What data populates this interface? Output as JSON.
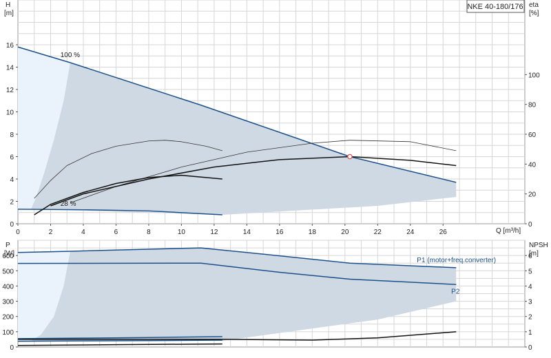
{
  "colors": {
    "envelope_fill": "#cfd9e3",
    "envelope_light": "#eaf3fb",
    "grid": "#d6d6d6",
    "pump_curve": "#1b4f8a",
    "thin_curve": "#333333",
    "eff_curve": "#111111",
    "duty_point": "#e04040"
  },
  "chart_data": [
    {
      "type": "line",
      "panel": "head",
      "title": "NKE 40-180/176",
      "xlabel": "Q [m³/h]",
      "ylabel": "H\n[m]",
      "y2label": "eta\n[%]",
      "xlim": [
        0,
        31
      ],
      "ylim": [
        0,
        20
      ],
      "y2lim": [
        0,
        150
      ],
      "x_ticks": [
        0,
        2,
        4,
        6,
        8,
        10,
        12,
        14,
        16,
        18,
        20,
        22,
        24,
        26
      ],
      "x_tick_labels": [
        "0",
        "2",
        "4",
        "6",
        "8",
        "10",
        "12",
        "14",
        "16",
        "18",
        "20",
        "22",
        "24",
        "26"
      ],
      "y_ticks": [
        0,
        2,
        4,
        6,
        8,
        10,
        12,
        14,
        16
      ],
      "y_tick_labels": [
        "0",
        "2",
        "4",
        "6",
        "8",
        "10",
        "12",
        "14",
        "16"
      ],
      "y2_ticks": [
        0,
        20,
        40,
        60,
        80,
        100
      ],
      "y2_tick_labels": [
        "0",
        "20",
        "40",
        "60",
        "80",
        "100"
      ],
      "grid": true,
      "labels": [
        {
          "text": "100 %",
          "x": 2.6,
          "y": 14.9
        },
        {
          "text": "28 %",
          "x": 2.6,
          "y": 1.6
        }
      ],
      "duty_point": {
        "x": 20.3,
        "y": 6.0
      },
      "envelope": {
        "upper": [
          [
            0.8,
            1.3
          ],
          [
            3.2,
            14.4
          ],
          [
            11.2,
            10.6
          ],
          [
            20.3,
            6.0
          ],
          [
            26.8,
            3.7
          ]
        ],
        "lower": [
          [
            26.8,
            2.4
          ],
          [
            22,
            1.6
          ],
          [
            12.5,
            0.8
          ],
          [
            3.2,
            1.2
          ],
          [
            0.8,
            1.3
          ]
        ]
      },
      "low_flow_zone": [
        [
          0,
          15.8
        ],
        [
          3.2,
          14.4
        ],
        [
          2.8,
          11
        ],
        [
          2.2,
          7.5
        ],
        [
          1.6,
          4.5
        ],
        [
          1.1,
          2.3
        ],
        [
          0.8,
          1.3
        ],
        [
          0,
          1.3
        ]
      ],
      "series": [
        {
          "role": "pump-100",
          "axis": "left",
          "style": "blue",
          "points": [
            [
              0,
              15.8
            ],
            [
              3.2,
              14.4
            ],
            [
              11.2,
              10.6
            ],
            [
              20.3,
              6.0
            ],
            [
              26.8,
              3.7
            ]
          ]
        },
        {
          "role": "pump-28",
          "axis": "left",
          "style": "blue",
          "points": [
            [
              0,
              1.3
            ],
            [
              4,
              1.25
            ],
            [
              8,
              1.15
            ],
            [
              12.5,
              0.8
            ]
          ]
        },
        {
          "role": "eff-100",
          "axis": "right",
          "style": "thin",
          "points": [
            [
              3.2,
              14
            ],
            [
              6,
              25
            ],
            [
              10,
              38
            ],
            [
              14,
              48
            ],
            [
              18,
              54
            ],
            [
              20.3,
              56
            ],
            [
              24,
              55
            ],
            [
              26.8,
              49
            ]
          ]
        },
        {
          "role": "eff-28",
          "axis": "right",
          "style": "thin",
          "points": [
            [
              1.0,
              17
            ],
            [
              2,
              29
            ],
            [
              3,
              39
            ],
            [
              4.5,
              47
            ],
            [
              6,
              52
            ],
            [
              8,
              55.5
            ],
            [
              9,
              56
            ],
            [
              10,
              55
            ],
            [
              11.5,
              52
            ],
            [
              12.5,
              49
            ]
          ]
        },
        {
          "role": "eff-mid",
          "axis": "right",
          "style": "bold",
          "points": [
            [
              2,
              12
            ],
            [
              4,
              20
            ],
            [
              8,
              30
            ],
            [
              12,
              38
            ],
            [
              16,
              43
            ],
            [
              20.3,
              45
            ],
            [
              24,
              42.5
            ],
            [
              26.8,
              39
            ]
          ]
        },
        {
          "role": "eff-28b",
          "axis": "right",
          "style": "bold",
          "points": [
            [
              1.0,
              6
            ],
            [
              2,
              13
            ],
            [
              4,
              21
            ],
            [
              6,
              27
            ],
            [
              8,
              31
            ],
            [
              10,
              32.5
            ],
            [
              12.5,
              30
            ]
          ]
        }
      ]
    },
    {
      "type": "line",
      "panel": "power",
      "xlabel": "",
      "ylabel": "P\n[W]",
      "y2label": "NPSH\n[m]",
      "xlim": [
        0,
        31
      ],
      "ylim": [
        0,
        700
      ],
      "y2lim": [
        0,
        7
      ],
      "y_ticks": [
        0,
        100,
        200,
        300,
        400,
        500,
        600
      ],
      "y_tick_labels": [
        "0",
        "100",
        "200",
        "300",
        "400",
        "500",
        "600"
      ],
      "y2_ticks": [
        0,
        1,
        2,
        3,
        4,
        5,
        6
      ],
      "y2_tick_labels": [
        "0",
        "1",
        "2",
        "3",
        "4",
        "5",
        "6"
      ],
      "grid": true,
      "labels": [
        {
          "text": "P1 (motor+freq.converter)",
          "x": 24.4,
          "y": 555
        },
        {
          "text": "P2",
          "x": 26.5,
          "y": 350
        }
      ],
      "envelope": {
        "upper": [
          [
            0,
            620
          ],
          [
            3.2,
            628
          ],
          [
            11.2,
            650
          ],
          [
            14,
            620
          ],
          [
            20.3,
            550
          ],
          [
            26.8,
            520
          ]
        ],
        "lower": [
          [
            26.8,
            300
          ],
          [
            22,
            180
          ],
          [
            12.5,
            40
          ],
          [
            3.2,
            40
          ],
          [
            0,
            40
          ]
        ]
      },
      "low_flow_zone": [
        [
          0,
          620
        ],
        [
          3.2,
          628
        ],
        [
          2.8,
          400
        ],
        [
          2.2,
          200
        ],
        [
          1.4,
          80
        ],
        [
          0.8,
          40
        ],
        [
          0,
          40
        ]
      ],
      "series": [
        {
          "role": "P1-100",
          "axis": "left",
          "style": "blue",
          "points": [
            [
              0,
              620
            ],
            [
              3.2,
              628
            ],
            [
              11.2,
              650
            ],
            [
              14,
              620
            ],
            [
              20.3,
              550
            ],
            [
              26.8,
              520
            ]
          ]
        },
        {
          "role": "P2-100",
          "axis": "left",
          "style": "blue",
          "points": [
            [
              0,
              548
            ],
            [
              11.2,
              550
            ],
            [
              16,
              490
            ],
            [
              20.3,
              445
            ],
            [
              26.8,
              410
            ]
          ]
        },
        {
          "role": "P1-28",
          "axis": "left",
          "style": "blue",
          "points": [
            [
              0,
              55
            ],
            [
              4,
              58
            ],
            [
              8,
              62
            ],
            [
              12.5,
              68
            ]
          ]
        },
        {
          "role": "P2-28",
          "axis": "left",
          "style": "blue",
          "points": [
            [
              0,
              38
            ],
            [
              4,
              40
            ],
            [
              8,
              42
            ],
            [
              12.5,
              45
            ]
          ]
        },
        {
          "role": "NPSH",
          "axis": "right",
          "style": "bold",
          "points": [
            [
              0,
              0.5
            ],
            [
              6,
              0.5
            ],
            [
              12.5,
              0.5
            ],
            [
              18,
              0.45
            ],
            [
              22,
              0.6
            ],
            [
              26.8,
              1.0
            ]
          ]
        },
        {
          "role": "NPSH-28",
          "axis": "right",
          "style": "bold",
          "points": [
            [
              0,
              0.1
            ],
            [
              6,
              0.15
            ],
            [
              12.5,
              0.2
            ]
          ]
        }
      ]
    }
  ]
}
